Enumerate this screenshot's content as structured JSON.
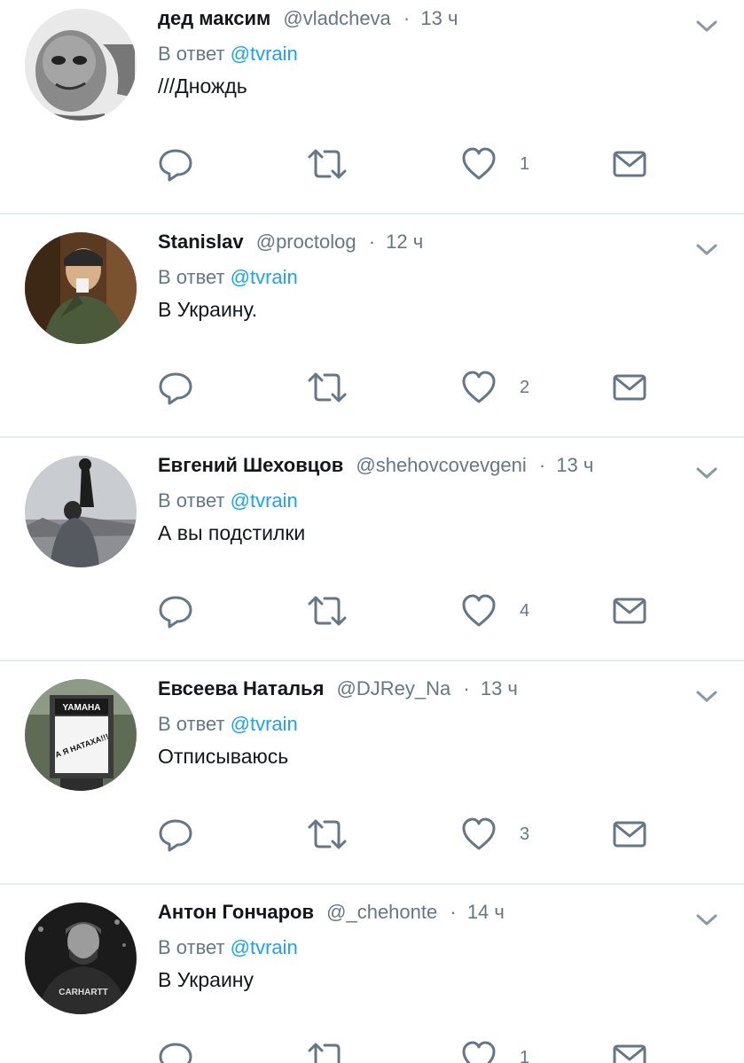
{
  "tweets": [
    {
      "name": "дед максим",
      "handle": "@vladcheva",
      "separator": "·",
      "time": "13 ч",
      "reply_prefix": "В ответ",
      "reply_to": "@tvrain",
      "text": "///Днождь",
      "like_count": "1"
    },
    {
      "name": "Stanislav",
      "handle": "@proctolog",
      "separator": "·",
      "time": "12 ч",
      "reply_prefix": "В ответ",
      "reply_to": "@tvrain",
      "text": "В Украину.",
      "like_count": "2"
    },
    {
      "name": "Евгений Шеховцов",
      "handle": "@shehovcovevgeni",
      "separator": "·",
      "time": "13 ч",
      "reply_prefix": "В ответ",
      "reply_to": "@tvrain",
      "text": "А вы подстилки",
      "like_count": "4"
    },
    {
      "name": "Евсеева Наталья",
      "handle": "@DJRey_Na",
      "separator": "·",
      "time": "13 ч",
      "reply_prefix": "В ответ",
      "reply_to": "@tvrain",
      "text": "Отписываюсь",
      "like_count": "3"
    },
    {
      "name": "Антон Гончаров",
      "handle": "@_chehonte",
      "separator": "·",
      "time": "14 ч",
      "reply_prefix": "В ответ",
      "reply_to": "@tvrain",
      "text": "В Украину",
      "like_count": "1"
    }
  ],
  "avatar_texts": {
    "yamaha_sign": "YAMAHA",
    "poster_text": "А Я НАТАХА!!!",
    "shirt_text": "CARHARTT"
  },
  "icons": {
    "reply": "reply-icon",
    "retweet": "retweet-icon",
    "like": "heart-icon",
    "dm": "envelope-icon",
    "menu": "chevron-down-icon"
  },
  "colors": {
    "name": "#14171a",
    "secondary": "#657786",
    "mention": "#1da1f2",
    "icon": "#657786",
    "divider": "#e6ecf0"
  }
}
